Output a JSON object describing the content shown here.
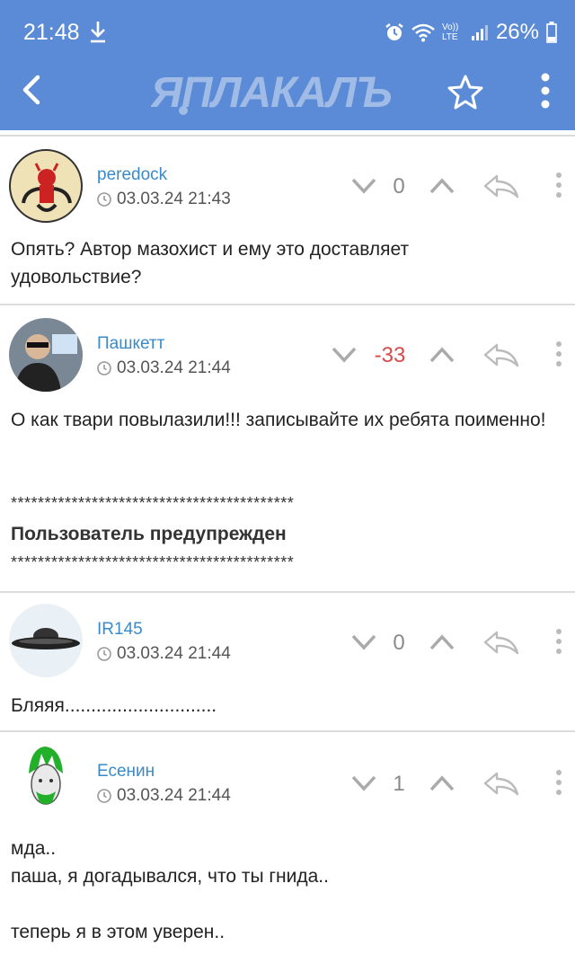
{
  "status": {
    "time": "21:48",
    "battery": "26%",
    "lte": "Vo)) LTE"
  },
  "header": {
    "logo": "ЯПЛАКАЛЪ"
  },
  "posts": [
    {
      "user": "peredock",
      "date": "03.03.24 21:43",
      "score": "0",
      "text": "Опять? Автор мазохист и ему это доставляет удовольствие?"
    },
    {
      "user": "Пашкетт",
      "date": "03.03.24 21:44",
      "score": "-33",
      "text": "О как твари повылазили!!! записывайте их ребята поименно!",
      "stars1": "******************************************",
      "warning": "Пользователь предупрежден",
      "stars2": "******************************************"
    },
    {
      "user": "IR145",
      "date": "03.03.24 21:44",
      "score": "0",
      "text": "Бляяя............................."
    },
    {
      "user": "Есенин",
      "date": "03.03.24 21:44",
      "score": "1",
      "text": "мда..\nпаша, я догадывался, что ты гнида..\n\nтеперь я в этом уверен.."
    }
  ]
}
